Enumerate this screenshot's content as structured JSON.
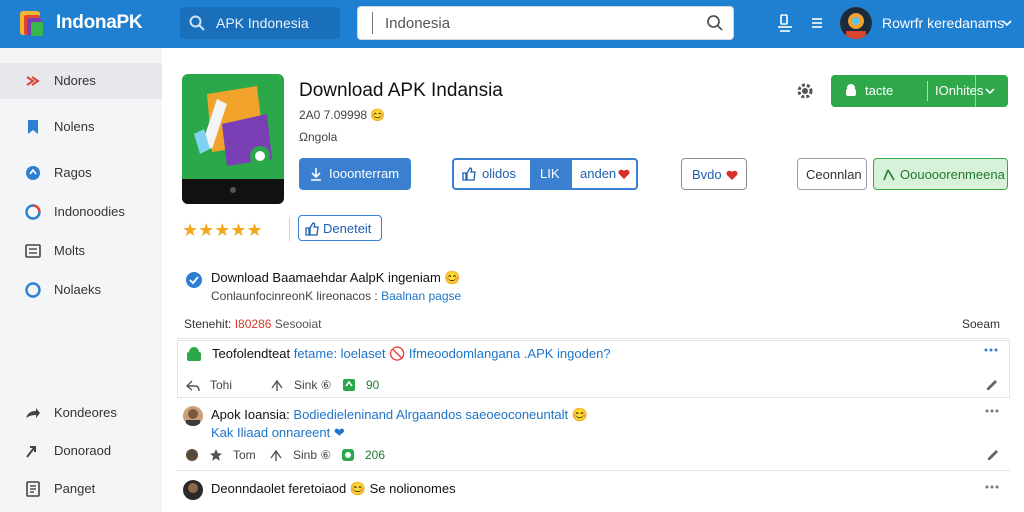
{
  "header": {
    "logo_text": "IndonaPK",
    "side_search_text": "APK Indonesia",
    "search_value": "Indonesia",
    "user_name": "Rowrfr keredanams"
  },
  "sidebar": {
    "items": [
      {
        "label": "Ndores",
        "icon": "crossed-arrows-icon"
      },
      {
        "label": "Nolens",
        "icon": "bookmark-icon"
      },
      {
        "label": "Ragos",
        "icon": "circle-icon"
      },
      {
        "label": "Indonoodies",
        "icon": "google-icon"
      },
      {
        "label": "Molts",
        "icon": "list-icon"
      },
      {
        "label": "Nolaeks",
        "icon": "ring-icon"
      },
      {
        "label": "Kondeores",
        "icon": "share-icon"
      },
      {
        "label": "Donoraod",
        "icon": "forward-icon"
      },
      {
        "label": "Panget",
        "icon": "document-icon"
      }
    ]
  },
  "app": {
    "title": "Download APK Indansia",
    "version": "2A0 7.09998 😊",
    "developer": "Ωngola",
    "rating_stars": "★★★★★",
    "install_label_1": "tacte",
    "install_label_2": "IOnhites",
    "download_label": "Iooonterram",
    "seg_label_1": "olidos",
    "seg_label_2": "LIK",
    "seg_label_3": "anden",
    "video_label": "Bvdo",
    "comment_label": "Ceonnlan",
    "green_label": "Oouooorenmeena",
    "denied_label": "Deneteit"
  },
  "notice": {
    "title": "Download Baamaehdar AalpK ingeniam 😊",
    "subtitle_prefix": "ConlaunfocinreonK lireonacos : ",
    "subtitle_link": "Baalnan pagse"
  },
  "filter": {
    "left_label": "Stenehit:",
    "left_value": "I80286",
    "left_suffix": "Sesooiat",
    "right_label": "Soeam"
  },
  "posts": [
    {
      "author": "Teofolendteat",
      "text": "fetame: loelaset 🚫 Ifmeoodomlangana .APK ingoden?",
      "actions": [
        {
          "label": "Tohi",
          "icon": "reply-icon"
        },
        {
          "label": "Sink ⑥",
          "icon": "repost-icon"
        },
        {
          "label": "90",
          "icon": "like-icon"
        }
      ]
    },
    {
      "author": "Apok Ioansia:",
      "text": "Bodiedieleninand Alrgaandos saeoeoconeuntalt 😊",
      "text2": "Kak Iliaad onnareent ❤",
      "actions": [
        {
          "label": "Tom",
          "icon": "star-icon"
        },
        {
          "label": "Sinb ⑥",
          "icon": "repost-icon"
        },
        {
          "label": "206",
          "icon": "like-icon"
        }
      ]
    },
    {
      "author": "Deonndaolet",
      "text": "feretoiaod 😊 Se nolionomes"
    }
  ]
}
